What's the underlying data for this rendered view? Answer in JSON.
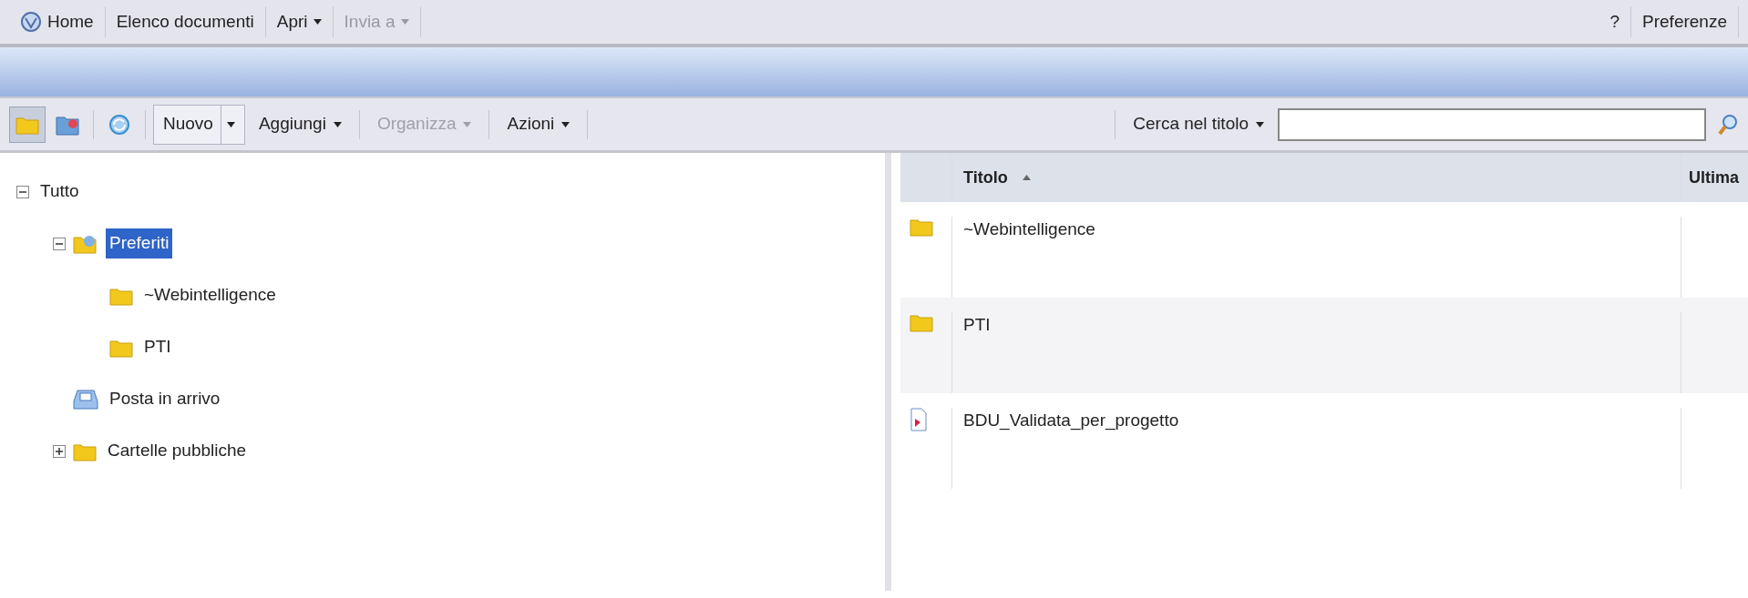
{
  "menu": {
    "left": [
      {
        "label": "Home",
        "kind": "home",
        "disabled": false
      },
      {
        "label": "Elenco documenti",
        "kind": "link",
        "disabled": false
      },
      {
        "label": "Apri",
        "kind": "dropdown",
        "disabled": false
      },
      {
        "label": "Invia a",
        "kind": "dropdown",
        "disabled": true
      }
    ],
    "right": [
      {
        "label": "?",
        "disabled": false
      },
      {
        "label": "Preferenze",
        "disabled": false
      }
    ]
  },
  "toolbar": {
    "views": [
      {
        "kind": "folder",
        "selected": true
      },
      {
        "kind": "categories",
        "selected": false
      },
      {
        "kind": "refresh",
        "selected": false
      }
    ],
    "buttons": [
      {
        "label": "Nuovo",
        "kind": "split",
        "disabled": false
      },
      {
        "label": "Aggiungi",
        "kind": "dropdown",
        "disabled": false
      },
      {
        "label": "Organizza",
        "kind": "dropdown",
        "disabled": true
      },
      {
        "label": "Azioni",
        "kind": "dropdown",
        "disabled": false
      }
    ],
    "search": {
      "label": "Cerca nel titolo"
    }
  },
  "tree": [
    {
      "label": "Tutto",
      "expanded": true,
      "selected": false,
      "children": [
        {
          "label": "Preferiti",
          "kind": "favorites",
          "expanded": true,
          "selected": true,
          "children": [
            {
              "label": "~Webintelligence",
              "kind": "folder",
              "selected": false
            },
            {
              "label": "PTI",
              "kind": "folder",
              "selected": false
            }
          ]
        },
        {
          "label": "Posta in arrivo",
          "kind": "inbox",
          "selected": false
        },
        {
          "label": "Cartelle pubbliche",
          "kind": "folder",
          "expanded": false,
          "selected": false
        }
      ]
    }
  ],
  "table": {
    "columns": [
      {
        "label": "Titolo",
        "sorted": true
      },
      {
        "label": "Ultima"
      }
    ],
    "rows": [
      {
        "kind": "folder",
        "title": "~Webintelligence"
      },
      {
        "kind": "folder",
        "title": "PTI"
      },
      {
        "kind": "document",
        "title": "BDU_Validata_per_progetto"
      }
    ]
  }
}
